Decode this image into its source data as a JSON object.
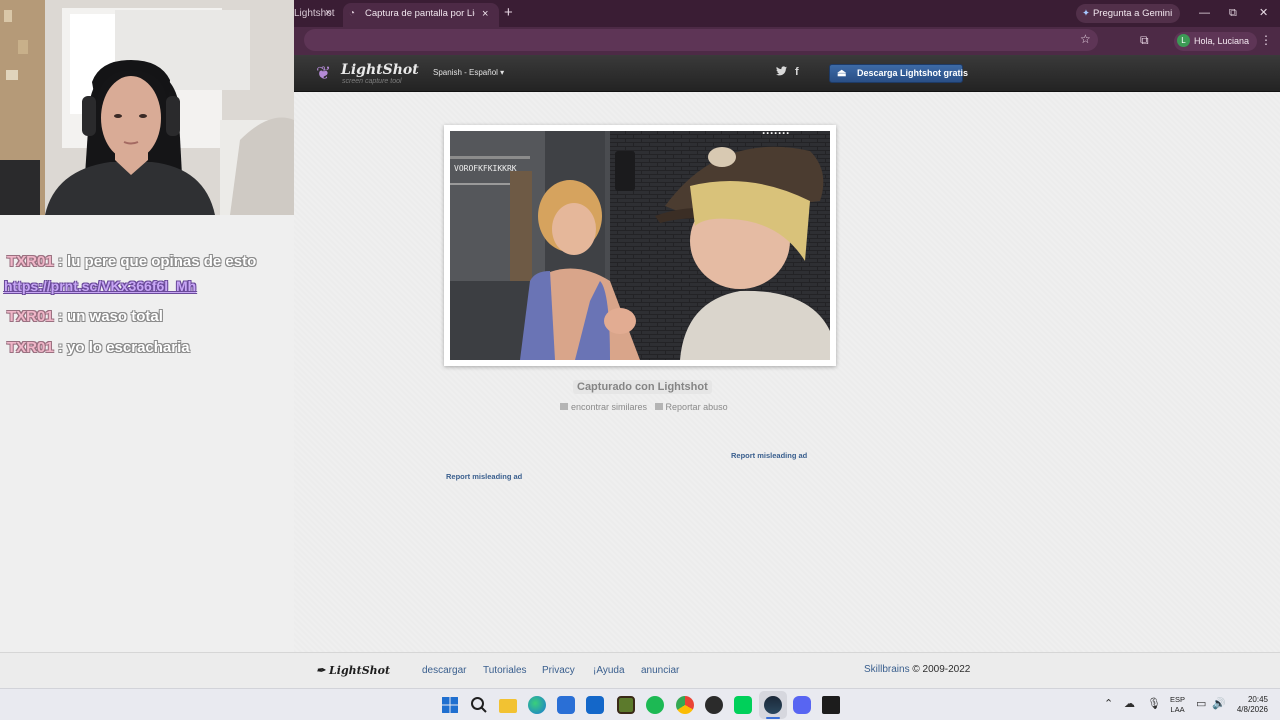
{
  "browser": {
    "prev_tab": {
      "title": "Lightshot",
      "close": "×"
    },
    "active_tab": {
      "title": "Captura de pantalla por Lightshot",
      "close": "×"
    },
    "new_tab": "+",
    "gemini_label": "Pregunta a Gemini",
    "window_controls": {
      "minimize": "—",
      "restore": "⧉",
      "close": "✕"
    },
    "profile_label": "Hola, Luciana",
    "profile_initial": "L"
  },
  "lightshot": {
    "logo_name": "LightShot",
    "logo_tagline": "screen capture tool",
    "language": "Spanish - Español ▾",
    "download_button": "Descarga Lightshot gratis",
    "caption": "Capturado con Lightshot",
    "find_similar": "encontrar similares",
    "report_abuse": "Reportar abuso",
    "ad_report_1": "Report misleading ad",
    "ad_report_2": "Report misleading ad",
    "screenshot_overlay_text": "VOROFKFKIKKRK"
  },
  "footer": {
    "logo": "LightShot",
    "links": [
      "descargar",
      "Tutoriales",
      "Privacy",
      "¡Ayuda",
      "anunciar"
    ],
    "company": "Skillbrains",
    "copyright": "© 2009-2022"
  },
  "chat": {
    "messages": [
      {
        "user": "TXR01",
        "separator": " : ",
        "text": "lu pere que opinas de esto"
      },
      {
        "user": "TXR01",
        "separator": " : ",
        "text": "un waso total"
      },
      {
        "user": "TXR01",
        "separator": " : ",
        "text": "yo lo escracharia"
      }
    ],
    "link": "https://prnt.sc/VKx366f6l_Mh"
  },
  "taskbar": {
    "language_top": "ESP",
    "language_bottom": "LAA",
    "time": "20:45",
    "date": "4/8/2026",
    "apps": [
      "windows-start",
      "search",
      "file-explorer",
      "edge",
      "store",
      "outlook",
      "minecraft",
      "spotify",
      "chrome",
      "obs",
      "overwolf",
      "steam",
      "discord",
      "epic-games"
    ]
  },
  "colors": {
    "tab_bar": "#3a1d34",
    "toolbar": "#4d2a46",
    "lightshot_header": "#2b2b2b",
    "download_button": "#2f5a94",
    "link_blue": "#3a5f8e",
    "chat_user": "#f0b6c8",
    "chat_link": "#c7a6f5"
  }
}
